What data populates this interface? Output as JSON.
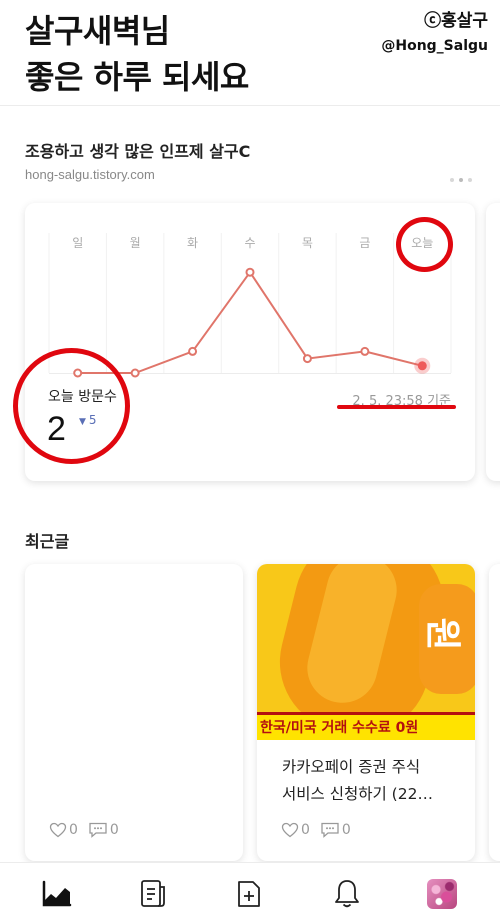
{
  "greeting": {
    "line1": "살구새벽님",
    "line2": "좋은 하루 되세요"
  },
  "watermark": {
    "line1": "ⓒ홍살구",
    "line2": "@Hong_Salgu"
  },
  "blog": {
    "name": "조용하고 생각 많은 인프제 살구C",
    "url": "hong-salgu.tistory.com"
  },
  "stats": {
    "days": [
      "일",
      "월",
      "화",
      "수",
      "목",
      "금",
      "오늘"
    ],
    "visitor_label": "오늘 방문수",
    "visitor_count": "2",
    "visitor_diff": "5",
    "timestamp": "2. 5. 23:58 기준",
    "colors": {
      "line": "#e0756a",
      "today_dot": "#ee5a5a",
      "highlight": "#e0070f"
    }
  },
  "chart_data": {
    "type": "line",
    "categories": [
      "일",
      "월",
      "화",
      "수",
      "목",
      "금",
      "오늘"
    ],
    "values": [
      0,
      0,
      3,
      14,
      2,
      3,
      1
    ],
    "ylim": [
      0,
      15
    ],
    "grid": true
  },
  "recent": {
    "title": "최근글",
    "posts": [
      {
        "title_line1": "",
        "title_line2": "",
        "likes": "0",
        "comments": "0"
      },
      {
        "thumb_banner": "한국/미국 거래 수수료 0원",
        "thumb_text": "원",
        "title_line1": "카카오페이 증권 주식",
        "title_line2": "서비스 신청하기 (22…",
        "likes": "0",
        "comments": "0"
      }
    ]
  },
  "nav": {
    "items": [
      {
        "icon": "stats-icon"
      },
      {
        "icon": "posts-icon"
      },
      {
        "icon": "new-post-icon"
      },
      {
        "icon": "notification-icon"
      },
      {
        "icon": "avatar"
      }
    ]
  }
}
